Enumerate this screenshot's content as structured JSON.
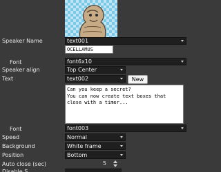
{
  "speaker_name": {
    "label": "Speaker Name",
    "value": "text001"
  },
  "speaker_text_value": "OCELLAMUS",
  "speaker_font": {
    "label": "Font",
    "value": "font6x10"
  },
  "speaker_align": {
    "label": "Speaker align",
    "value": "Top Center"
  },
  "text": {
    "label": "Text",
    "value": "text002",
    "new_button": "New"
  },
  "text_body": [
    "Can you keep a secret?",
    "You can now create text boxes that",
    "close with a timer..."
  ],
  "body_font": {
    "label": "Font",
    "value": "font003"
  },
  "speed": {
    "label": "Speed",
    "value": "Normal"
  },
  "background": {
    "label": "Background",
    "value": "White frame"
  },
  "position": {
    "label": "Position",
    "value": "Bottom"
  },
  "auto_close": {
    "label": "Auto close (sec)",
    "value": "5"
  },
  "next_label_partial": "Disable S",
  "icons": {
    "dropdown": "chevron-down-icon",
    "spinner": "spinner-arrows-icon"
  }
}
